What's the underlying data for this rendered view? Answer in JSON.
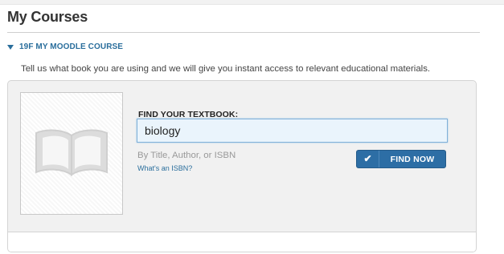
{
  "page": {
    "title": "My Courses"
  },
  "course": {
    "name": "19F MY MOODLE COURSE"
  },
  "intro_text": "Tell us what book you are using and we will give you instant access to relevant educational materials.",
  "textbook_finder": {
    "label": "FIND YOUR TEXTBOOK:",
    "search_value": "biology",
    "hint": "By Title, Author, or ISBN",
    "isbn_link": "What's an ISBN?",
    "button_label": "FIND NOW",
    "button_icon": "check-icon",
    "placeholder_icon": "open-book-icon"
  },
  "colors": {
    "link": "#2a6e9c",
    "button": "#2d6ea5",
    "panel_bg": "#f1f1f1",
    "input_bg": "#eaf4fc"
  }
}
